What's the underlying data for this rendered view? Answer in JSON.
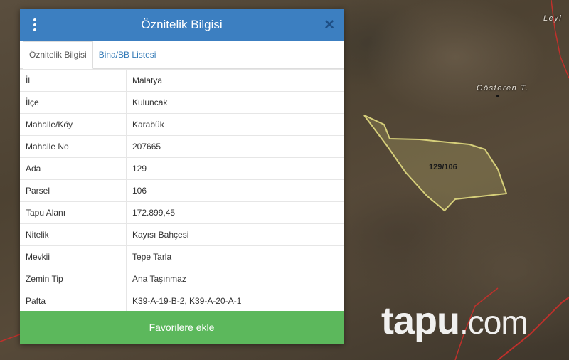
{
  "dialog": {
    "title": "Öznitelik Bilgisi",
    "close_glyph": "✕",
    "tabs": [
      {
        "label": "Öznitelik Bilgisi",
        "active": true
      },
      {
        "label": "Bina/BB Listesi",
        "active": false
      }
    ],
    "rows": [
      {
        "key": "İl",
        "value": "Malatya"
      },
      {
        "key": "İlçe",
        "value": "Kuluncak"
      },
      {
        "key": "Mahalle/Köy",
        "value": "Karabük"
      },
      {
        "key": "Mahalle No",
        "value": "207665"
      },
      {
        "key": "Ada",
        "value": "129"
      },
      {
        "key": "Parsel",
        "value": "106"
      },
      {
        "key": "Tapu Alanı",
        "value": "172.899,45"
      },
      {
        "key": "Nitelik",
        "value": "Kayısı Bahçesi"
      },
      {
        "key": "Mevkii",
        "value": "Tepe Tarla"
      },
      {
        "key": "Zemin Tip",
        "value": "Ana Taşınmaz"
      },
      {
        "key": "Pafta",
        "value": "K39-A-19-B-2, K39-A-20-A-1"
      }
    ],
    "favorite_button": "Favorilere ekle"
  },
  "map": {
    "parcel_label": "129/106",
    "place_labels": {
      "top_right": "Leyl",
      "hill": "Gösteren T."
    },
    "watermark": {
      "main": "tapu",
      "domain": ".com"
    }
  },
  "colors": {
    "header": "#3c7fc1",
    "button": "#5cb85c",
    "parcel_outline": "#d6cf7a",
    "boundary_red": "#c0302b"
  }
}
